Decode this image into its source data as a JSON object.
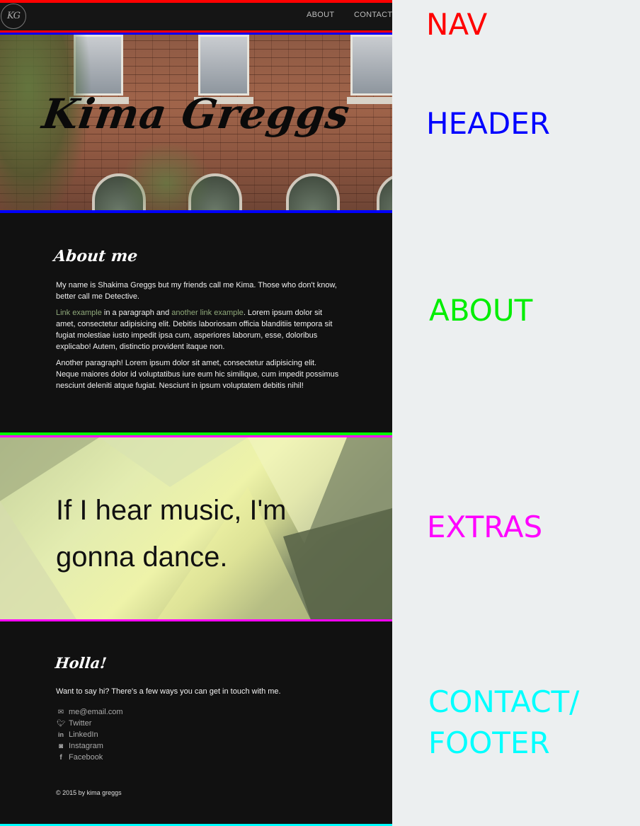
{
  "nav": {
    "logo": "KG",
    "links": [
      "ABOUT",
      "CONTACT"
    ]
  },
  "header": {
    "title": "Kima Greggs"
  },
  "about": {
    "heading": "About me",
    "p1": "My name is Shakima Greggs but my friends call me Kima. Those who don't know, better call me Detective.",
    "p2_link1": "Link example",
    "p2_text1": " in a paragraph and ",
    "p2_link2": "another link example",
    "p2_text2": ". Lorem ipsum dolor sit amet, consectetur adipisicing elit. Debitis laboriosam officia blanditiis tempora sit fugiat molestiae iusto impedit ipsa cum, asperiores laborum, esse, doloribus explicabo! Autem, distinctio provident itaque non.",
    "p3": "Another paragraph! Lorem ipsum dolor sit amet, consectetur adipisicing elit. Neque maiores dolor id voluptatibus iure eum hic similique, cum impedit possimus nesciunt deleniti atque fugiat. Nesciunt in ipsum voluptatem debitis nihil!"
  },
  "extras": {
    "quote": "If I hear music, I'm gonna dance."
  },
  "contact": {
    "heading": "Holla!",
    "intro": "Want to say hi? There's a few ways you can get in touch with me.",
    "links": [
      {
        "icon": "envelope-icon",
        "label": "me@email.com"
      },
      {
        "icon": "twitter-icon",
        "label": "Twitter"
      },
      {
        "icon": "linkedin-icon",
        "label": "LinkedIn"
      },
      {
        "icon": "instagram-icon",
        "label": "Instagram"
      },
      {
        "icon": "facebook-icon",
        "label": "Facebook"
      }
    ],
    "copyright": "© 2015 by kima greggs"
  },
  "annotations": {
    "nav": "NAV",
    "header": "HEADER",
    "about": "ABOUT",
    "extras": "EXTRAS",
    "contact": "CONTACT/ FOOTER",
    "colors": {
      "nav": "#ff0000",
      "header": "#0000ff",
      "about": "#00ee00",
      "extras": "#ff00ff",
      "contact": "#00ffff"
    }
  }
}
